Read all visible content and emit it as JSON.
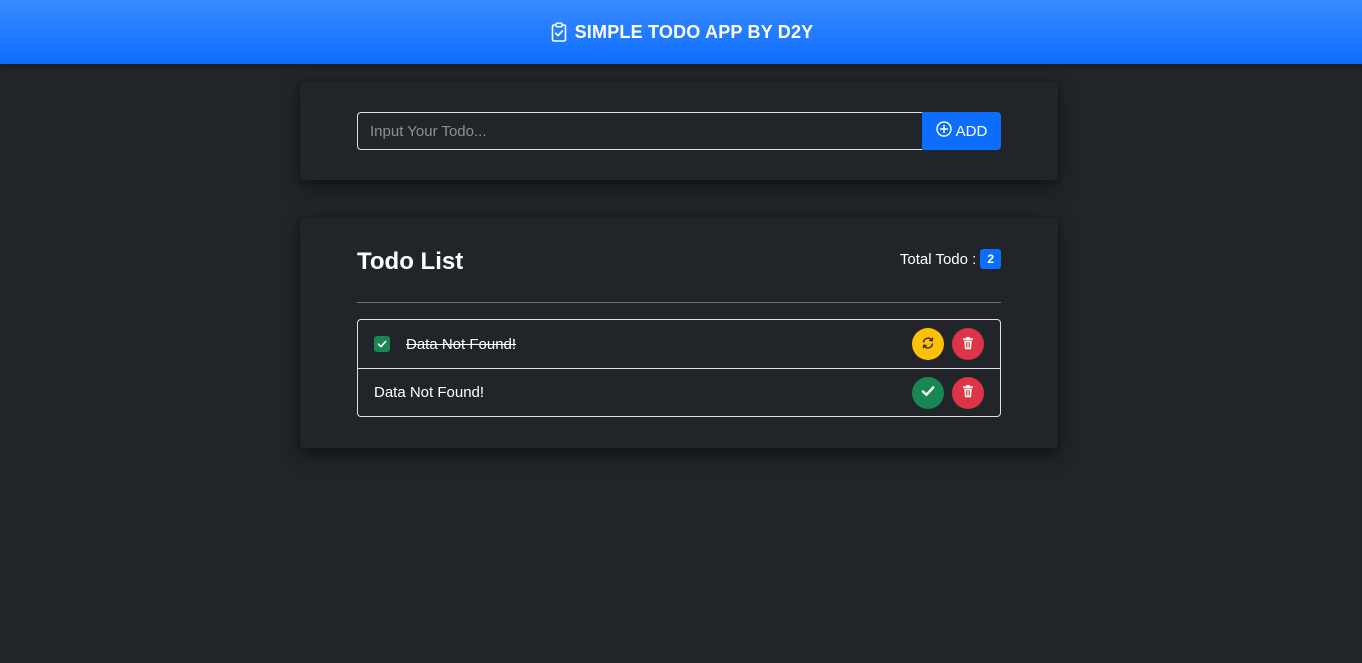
{
  "app": {
    "title": "SIMPLE TODO APP BY D2Y",
    "icon": "clipboard-check-icon",
    "accent": "#0d6efd"
  },
  "form": {
    "placeholder": "Input Your Todo...",
    "value": "",
    "add_label": "ADD",
    "add_icon": "plus-circle-icon"
  },
  "list": {
    "title": "Todo List",
    "total_label": "Total Todo :",
    "total_count": "2",
    "items": [
      {
        "text": "Data Not Found!",
        "completed": true,
        "actions": [
          "undo-icon",
          "trash-icon"
        ]
      },
      {
        "text": "Data Not Found!",
        "completed": false,
        "actions": [
          "check-icon",
          "trash-icon"
        ]
      }
    ]
  },
  "colors": {
    "background": "#212529",
    "primary": "#0d6efd",
    "warning": "#ffc107",
    "danger": "#dc3545",
    "success": "#198754"
  }
}
